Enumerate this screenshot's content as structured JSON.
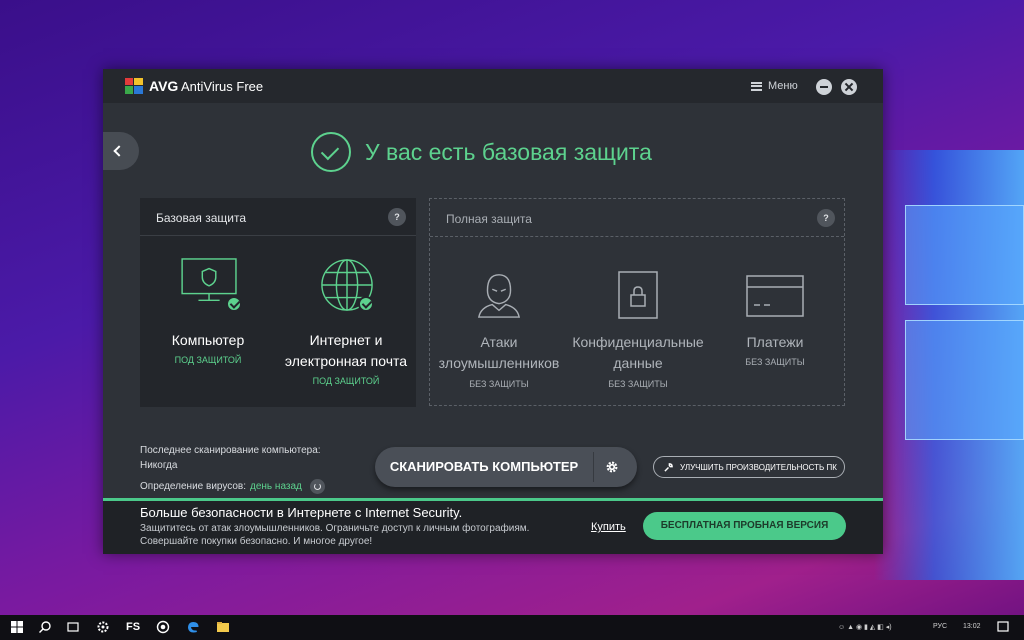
{
  "app": {
    "brand": "AVG",
    "product": "AntiVirus Free",
    "menu_label": "Меню"
  },
  "status": {
    "title": "У вас есть базовая защита"
  },
  "basic_panel": {
    "title": "Базовая защита",
    "help": "?",
    "features": [
      {
        "name_line1": "Компьютер",
        "name_line2": "",
        "status": "ПОД ЗАЩИТОЙ"
      },
      {
        "name_line1": "Интернет и",
        "name_line2": "электронная почта",
        "status": "ПОД ЗАЩИТОЙ"
      }
    ]
  },
  "full_panel": {
    "title": "Полная защита",
    "help": "?",
    "features": [
      {
        "name_line1": "Атаки",
        "name_line2": "злоумышленников",
        "status": "БЕЗ ЗАЩИТЫ"
      },
      {
        "name_line1": "Конфиденциальные",
        "name_line2": "данные",
        "status": "БЕЗ ЗАЩИТЫ"
      },
      {
        "name_line1": "Платежи",
        "name_line2": "",
        "status": "БЕЗ ЗАЩИТЫ"
      }
    ]
  },
  "scan_info": {
    "last_scan_label": "Последнее сканирование компьютера:",
    "last_scan_value": "Никогда",
    "definitions_label": "Определение вирусов:",
    "definitions_value": "день назад"
  },
  "scan_button": {
    "label": "СКАНИРОВАТЬ КОМПЬЮТЕР"
  },
  "performance_button": {
    "label": "УЛУЧШИТЬ ПРОИЗВОДИТЕЛЬНОСТЬ ПК"
  },
  "promo": {
    "title": "Больше безопасности в Интернете с Internet Security.",
    "text": "Защититесь от атак злоумышленников. Ограничьте доступ к личным фотографиям. Совершайте покупки безопасно. И многое другое!",
    "buy_label": "Купить",
    "trial_label": "БЕСПЛАТНАЯ ПРОБНАЯ ВЕРСИЯ"
  },
  "taskbar": {
    "fs_label": "FS",
    "language": "РУС",
    "time": "13:02"
  },
  "colors": {
    "accent_green": "#5dd28e",
    "window_bg": "#2e3238",
    "promo_button": "#4bc98a"
  }
}
